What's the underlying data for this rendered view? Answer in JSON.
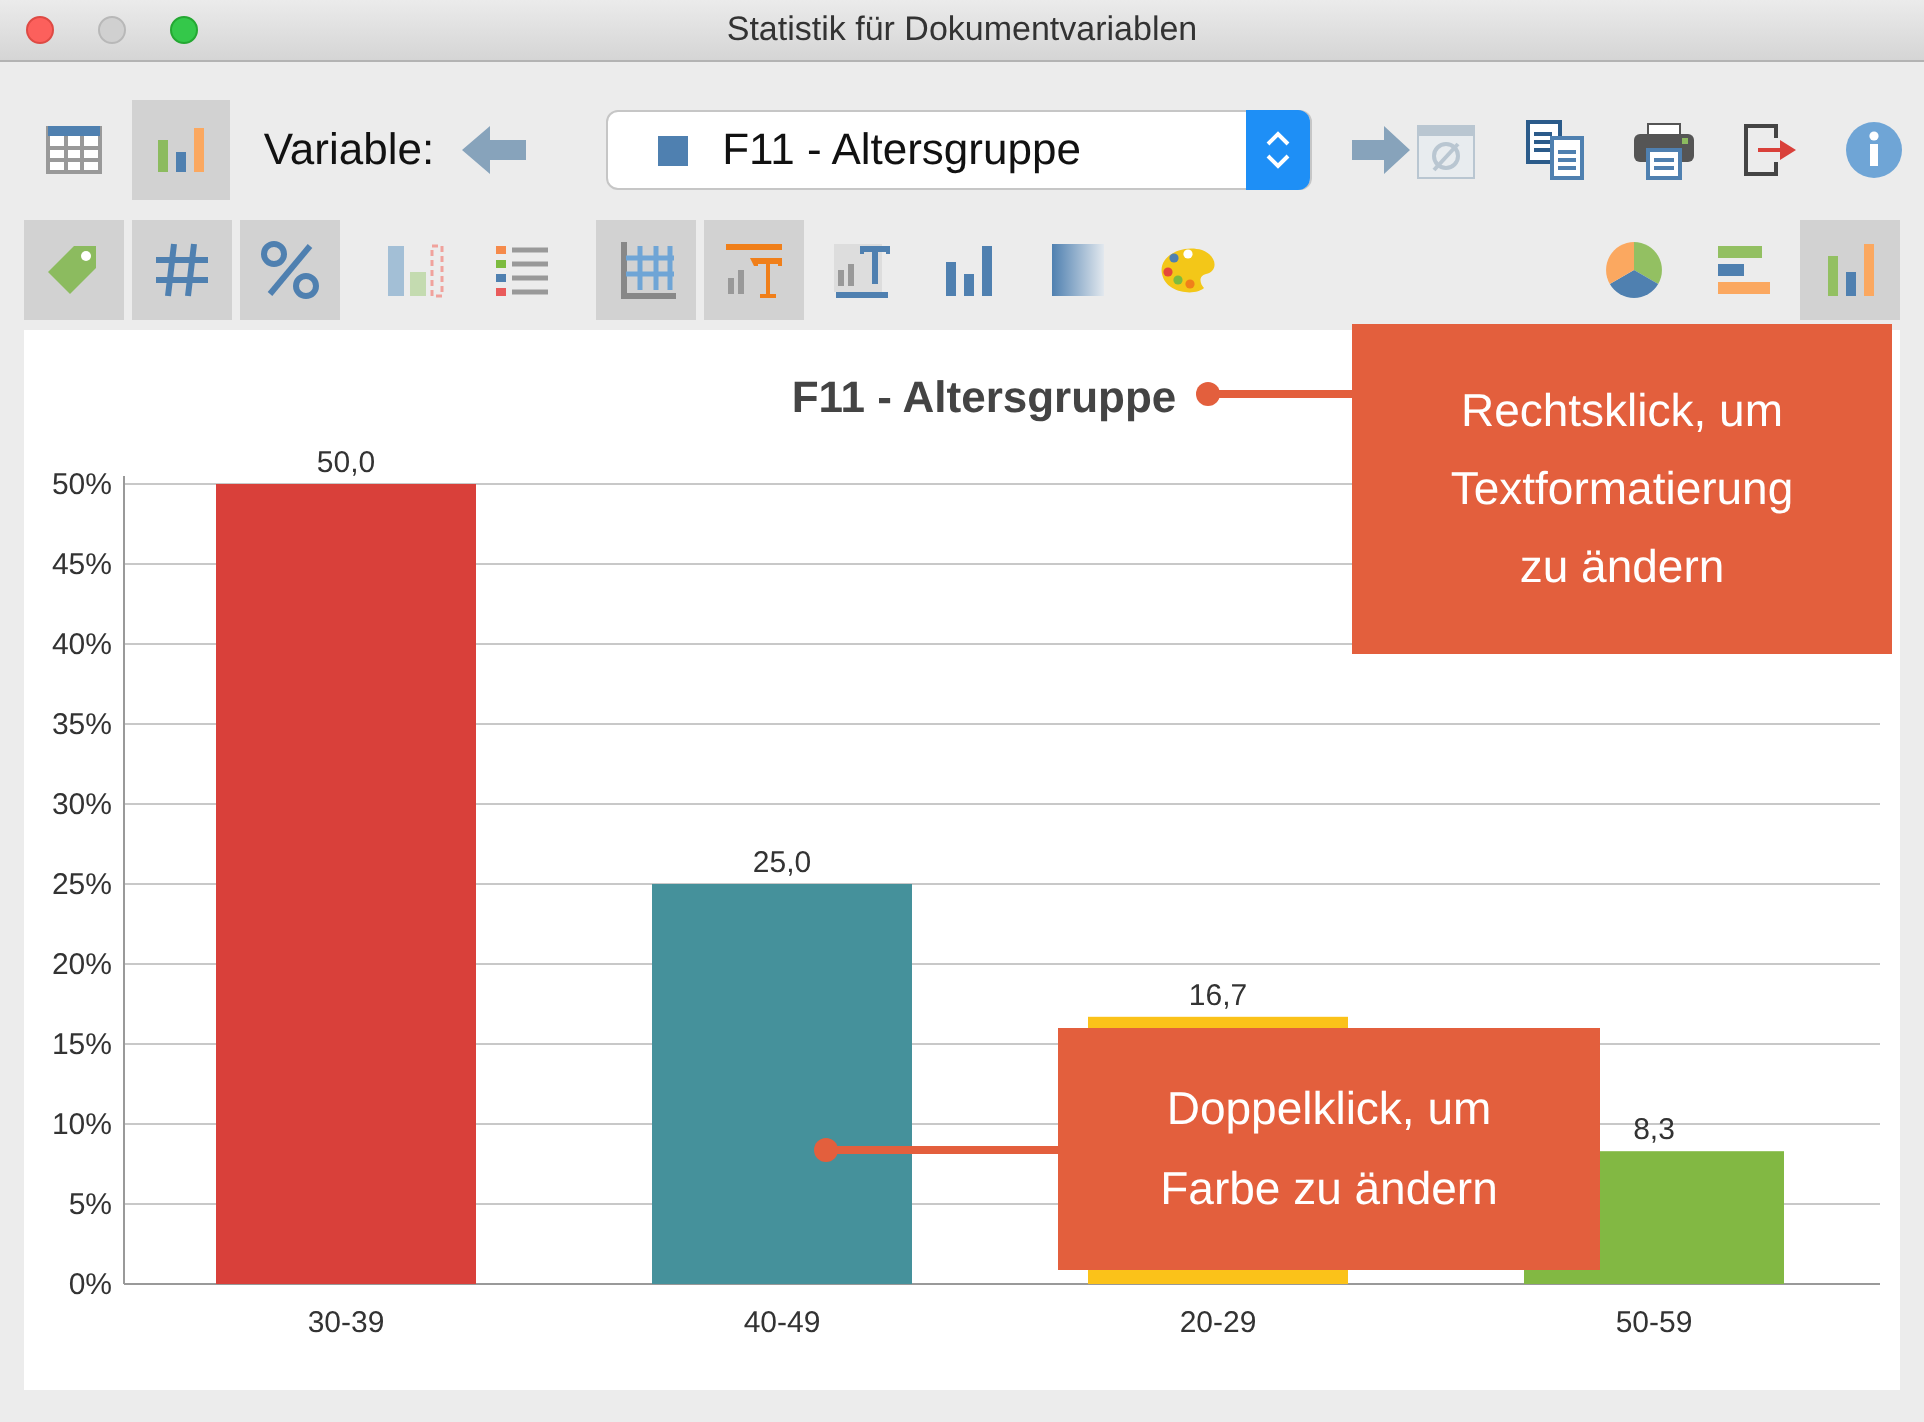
{
  "window": {
    "title": "Statistik für Dokumentvariablen"
  },
  "toolbar": {
    "view_buttons": [
      {
        "selected": false
      },
      {
        "selected": true
      }
    ],
    "variable_label": "Variable:",
    "variable_select": {
      "value": "F11 - Altersgruppe"
    }
  },
  "format_bar": {
    "buttons": [
      {
        "selected": true
      },
      {
        "selected": true
      },
      {
        "selected": true
      },
      {
        "selected": false
      },
      {
        "selected": false
      },
      {
        "selected": true
      },
      {
        "selected": true
      },
      {
        "selected": false
      },
      {
        "selected": false
      },
      {
        "selected": false
      },
      {
        "selected": false
      }
    ],
    "chart_type_buttons": [
      {
        "selected": false
      },
      {
        "selected": false
      },
      {
        "selected": true
      }
    ]
  },
  "chart": {
    "bars": [
      {
        "color": "#d9403a"
      },
      {
        "color": "#45919b"
      },
      {
        "color": "#fbc219"
      },
      {
        "color": "#82b843"
      }
    ],
    "chart_data": {
      "type": "bar",
      "grid": true,
      "title": "F11 - Altersgruppe",
      "categories": [
        "30-39",
        "40-49",
        "20-29",
        "50-59"
      ],
      "values": [
        50.0,
        25.0,
        16.7,
        8.3
      ],
      "ylim": [
        0,
        50
      ],
      "yticks": [
        {
          "value": 0,
          "label": "0%"
        },
        {
          "value": 5,
          "label": "5%"
        },
        {
          "value": 10,
          "label": "10%"
        },
        {
          "value": 15,
          "label": "15%"
        },
        {
          "value": 20,
          "label": "20%"
        },
        {
          "value": 25,
          "label": "25%"
        },
        {
          "value": 30,
          "label": "30%"
        },
        {
          "value": 35,
          "label": "35%"
        },
        {
          "value": 40,
          "label": "40%"
        },
        {
          "value": 45,
          "label": "45%"
        },
        {
          "value": 50,
          "label": "50%"
        }
      ],
      "value_labels": [
        "50,0",
        "25,0",
        "16,7",
        "8,3"
      ]
    }
  },
  "callouts": [
    {
      "lines": [
        "Rechtsklick, um",
        "Textformatierung",
        "zu ändern"
      ]
    },
    {
      "lines": [
        "Doppelklick, um",
        "Farbe zu ändern"
      ]
    }
  ]
}
